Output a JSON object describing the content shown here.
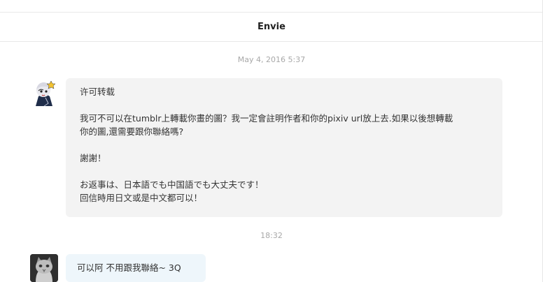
{
  "conversation": {
    "title": "Envie"
  },
  "messages": [
    {
      "timestamp": "May 4, 2016 5:37",
      "sender": "them",
      "lines": [
        "许可转载",
        "",
        "我可不可以在tumblr上轉載你畫的圖？我一定會註明作者和你的pixiv url放上去.如果以後想轉載",
        "你的圖,還需要跟你聯絡嗎?",
        "",
        "謝謝！",
        "",
        "お返事は、日本語でも中国語でも大丈夫です！",
        "回信時用日文或是中文都可以！"
      ]
    },
    {
      "timestamp": "18:32",
      "sender": "me",
      "lines": [
        "可以阿 不用跟我聯絡~ 3Q"
      ]
    }
  ],
  "icons": {
    "avatar_1": "anime-character-avatar",
    "avatar_2": "cat-avatar"
  },
  "colors": {
    "incoming_bubble": "#f3f3f3",
    "outgoing_bubble": "#eef6fb",
    "timestamp": "#a8a8a8"
  }
}
